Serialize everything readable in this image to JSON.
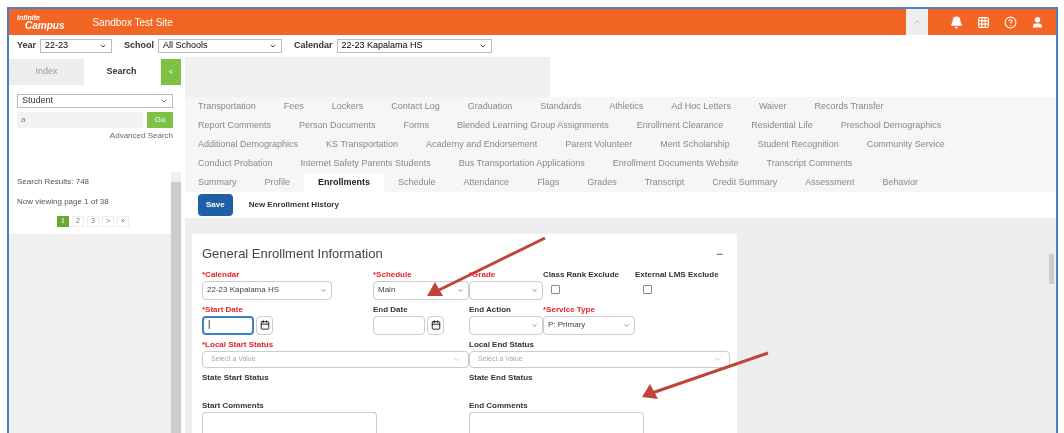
{
  "header": {
    "logo_top": "Infinite",
    "logo_bottom": "Campus",
    "site_title": "Sandbox Test Site"
  },
  "toolbar": [
    {
      "label": "Year",
      "value": "22-23"
    },
    {
      "label": "School",
      "value": "All Schools"
    },
    {
      "label": "Calendar",
      "value": "22-23 Kapalama HS"
    }
  ],
  "sidebar": {
    "tabs": [
      {
        "label": "Index",
        "selected": false
      },
      {
        "label": "Search",
        "selected": true
      }
    ],
    "collapse_label": "<",
    "search_type": "Student",
    "query": "a",
    "go": "Go",
    "advanced": "Advanced Search",
    "results": "Search Results: 748",
    "viewing": "Now viewing page 1 of 38",
    "pages": [
      {
        "label": "1",
        "selected": true
      },
      {
        "label": "2",
        "selected": false
      },
      {
        "label": "3",
        "selected": false
      },
      {
        "label": ">",
        "selected": false
      },
      {
        "label": "»",
        "selected": false
      }
    ]
  },
  "tab_rows": [
    [
      {
        "label": "Transportation",
        "selected": false
      },
      {
        "label": "Fees",
        "selected": false
      },
      {
        "label": "Lockers",
        "selected": false
      },
      {
        "label": "Contact Log",
        "selected": false
      },
      {
        "label": "Graduation",
        "selected": false
      },
      {
        "label": "Standards",
        "selected": false
      },
      {
        "label": "Athletics",
        "selected": false
      },
      {
        "label": "Ad Hoc Letters",
        "selected": false
      },
      {
        "label": "Waiver",
        "selected": false
      },
      {
        "label": "Records Transfer",
        "selected": false
      }
    ],
    [
      {
        "label": "Report Comments",
        "selected": false
      },
      {
        "label": "Person Documents",
        "selected": false
      },
      {
        "label": "Forms",
        "selected": false
      },
      {
        "label": "Blended Learning Group Assignments",
        "selected": false
      },
      {
        "label": "Enrollment Clearance",
        "selected": false
      },
      {
        "label": "Residential Life",
        "selected": false
      },
      {
        "label": "Preschool Demographics",
        "selected": false
      }
    ],
    [
      {
        "label": "Additional Demographics",
        "selected": false
      },
      {
        "label": "KS Transportation",
        "selected": false
      },
      {
        "label": "Academy and Endorsement",
        "selected": false
      },
      {
        "label": "Parent Volunteer",
        "selected": false
      },
      {
        "label": "Merit Scholarship",
        "selected": false
      },
      {
        "label": "Student Recognition",
        "selected": false
      },
      {
        "label": "Community Service",
        "selected": false
      }
    ],
    [
      {
        "label": "Conduct Probation",
        "selected": false
      },
      {
        "label": "Internet Safety Parents Students",
        "selected": false
      },
      {
        "label": "Bus Transportation Applications",
        "selected": false
      },
      {
        "label": "Enrollment Documents Website",
        "selected": false
      },
      {
        "label": "Transcript Comments",
        "selected": false
      }
    ],
    [
      {
        "label": "Summary",
        "selected": false
      },
      {
        "label": "Profile",
        "selected": false
      },
      {
        "label": "Enrollments",
        "selected": true
      },
      {
        "label": "Schedule",
        "selected": false
      },
      {
        "label": "Attendance",
        "selected": false
      },
      {
        "label": "Flags",
        "selected": false
      },
      {
        "label": "Grades",
        "selected": false
      },
      {
        "label": "Transcript",
        "selected": false
      },
      {
        "label": "Credit Summary",
        "selected": false
      },
      {
        "label": "Assessment",
        "selected": false
      },
      {
        "label": "Behavior",
        "selected": false
      }
    ]
  ],
  "actions": [
    {
      "label": "Save",
      "kind": "primary"
    },
    {
      "label": "New Enrollment History",
      "kind": "plain"
    }
  ],
  "form": {
    "title": "General Enrollment Information",
    "collapse": "−",
    "fields": [
      {
        "kind": "select",
        "label": "*Calendar",
        "required": true,
        "value": "22-23 Kapalama HS"
      },
      {
        "kind": "select",
        "label": "*Schedule",
        "required": true,
        "value": "Main"
      },
      {
        "kind": "select",
        "label": "*Grade",
        "required": true
      },
      {
        "kind": "checkbox",
        "label": "Class Rank Exclude",
        "required": false,
        "checked": false
      },
      {
        "kind": "checkbox",
        "label": "External LMS Exclude",
        "required": false,
        "checked": false
      },
      {
        "kind": "date",
        "label": "*Start Date",
        "required": true,
        "focused": true,
        "value": "|"
      },
      {
        "kind": "date",
        "label": "End Date",
        "required": false,
        "focused": false
      },
      {
        "kind": "select",
        "label": "End Action",
        "required": false
      },
      {
        "kind": "select",
        "label": "*Service Type",
        "required": true,
        "value": "P: Primary"
      },
      {
        "kind": "wide",
        "label": "*Local Start Status",
        "required": true,
        "placeholder": "Select a Value"
      },
      {
        "kind": "wide",
        "label": "Local End Status",
        "required": false,
        "placeholder": "Select a Value"
      },
      {
        "kind": "text",
        "label": "State Start Status",
        "required": false
      },
      {
        "kind": "text",
        "label": "State End Status",
        "required": false
      },
      {
        "kind": "textarea",
        "label": "Start Comments",
        "required": false
      },
      {
        "kind": "textarea",
        "label": "End Comments",
        "required": false
      }
    ]
  }
}
